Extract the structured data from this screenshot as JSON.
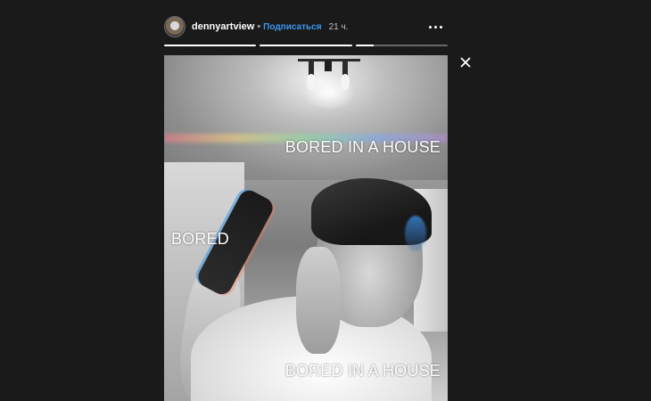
{
  "story": {
    "username": "dennyartview",
    "separator": "•",
    "follow_label": "Подписаться",
    "time_ago": "21 ч.",
    "progress": [
      1,
      1,
      0.2
    ],
    "captions": {
      "top": "BORED IN A HOUSE",
      "middle": "BORED",
      "bottom": "BORED IN A HOUSE"
    }
  },
  "colors": {
    "background": "#1a1a1a",
    "follow_link": "#3897f0",
    "text": "#ffffff"
  },
  "icons": {
    "more": "more-dots-icon",
    "close": "close-icon"
  }
}
